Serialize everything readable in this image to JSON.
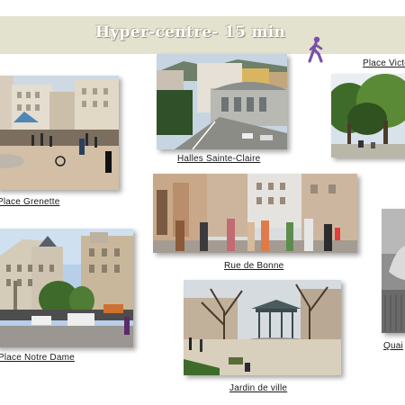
{
  "banner": {
    "title": "Hyper-centre-  15  min",
    "walk_icon": "walking-person-icon",
    "background_color": "#e3e2cf",
    "icon_color": "#7b4fa8"
  },
  "photos": [
    {
      "caption": "Place Victo",
      "subject": "park-trees-photo"
    },
    {
      "caption": "Halles Sainte-Claire",
      "subject": "market-hall-street-photo"
    },
    {
      "caption": "Place Grenette",
      "subject": "square-with-fountain-photo"
    },
    {
      "caption": "Rue de Bonne",
      "subject": "pedestrian-street-photo"
    },
    {
      "caption": "Place Notre Dame",
      "subject": "square-with-buildings-photo"
    },
    {
      "caption": "Jardin de ville",
      "subject": "garden-kiosk-photo"
    },
    {
      "caption": "Quai",
      "subject": "riverside-statue-photo"
    }
  ]
}
